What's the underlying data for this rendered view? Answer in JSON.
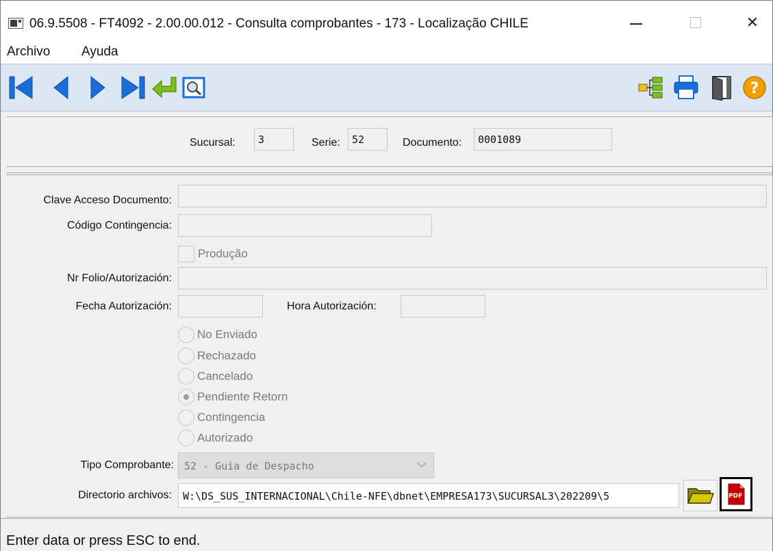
{
  "window": {
    "title": "06.9.5508 - FT4092 - 2.00.00.012 - Consulta comprobantes - 173 - Localização CHILE",
    "close_glyph": "✕"
  },
  "menu": {
    "items": [
      "Archivo",
      "Ayuda"
    ]
  },
  "toolbar": {
    "icons": [
      "first-record-icon",
      "previous-record-icon",
      "next-record-icon",
      "last-record-icon",
      "enter-icon",
      "view-icon",
      "tree-icon",
      "print-icon",
      "exit-door-icon",
      "help-icon"
    ]
  },
  "header": {
    "sucursal_label": "Sucursal:",
    "sucursal_value": "3",
    "serie_label": "Serie:",
    "serie_value": "52",
    "documento_label": "Documento:",
    "documento_value": "0001089"
  },
  "form": {
    "clave_label": "Clave Acceso Documento:",
    "clave_value": "",
    "codigo_label": "Código Contingencia:",
    "codigo_value": "",
    "producao_label": "Produção",
    "producao_checked": false,
    "nrfolio_label": "Nr Folio/Autorización:",
    "nrfolio_value": "",
    "fecha_label": "Fecha Autorización:",
    "fecha_value": "",
    "hora_label": "Hora Autorización:",
    "hora_value": "",
    "status_options": [
      "No Enviado",
      "Rechazado",
      "Cancelado",
      "Pendiente Retorn",
      "Contingencia",
      "Autorizado"
    ],
    "status_selected": "Pendiente Retorn",
    "tipo_label": "Tipo Comprobante:",
    "tipo_value": "52 - Guia de Despacho",
    "directorio_label": "Directorio archivos:",
    "directorio_value": "W:\\DS_SUS_INTERNACIONAL\\Chile-NFE\\dbnet\\EMPRESA173\\SUCURSAL3\\202209\\5",
    "pdf_text": "PDF"
  },
  "status_bar": {
    "text": "Enter data or press ESC to end."
  },
  "colors": {
    "toolbar_blue": "#1a6fd6",
    "enter_green": "#7cbf1e",
    "help_orange": "#f0a000",
    "folder_olive": "#8b8b1a",
    "pdf_red": "#cc0000"
  }
}
